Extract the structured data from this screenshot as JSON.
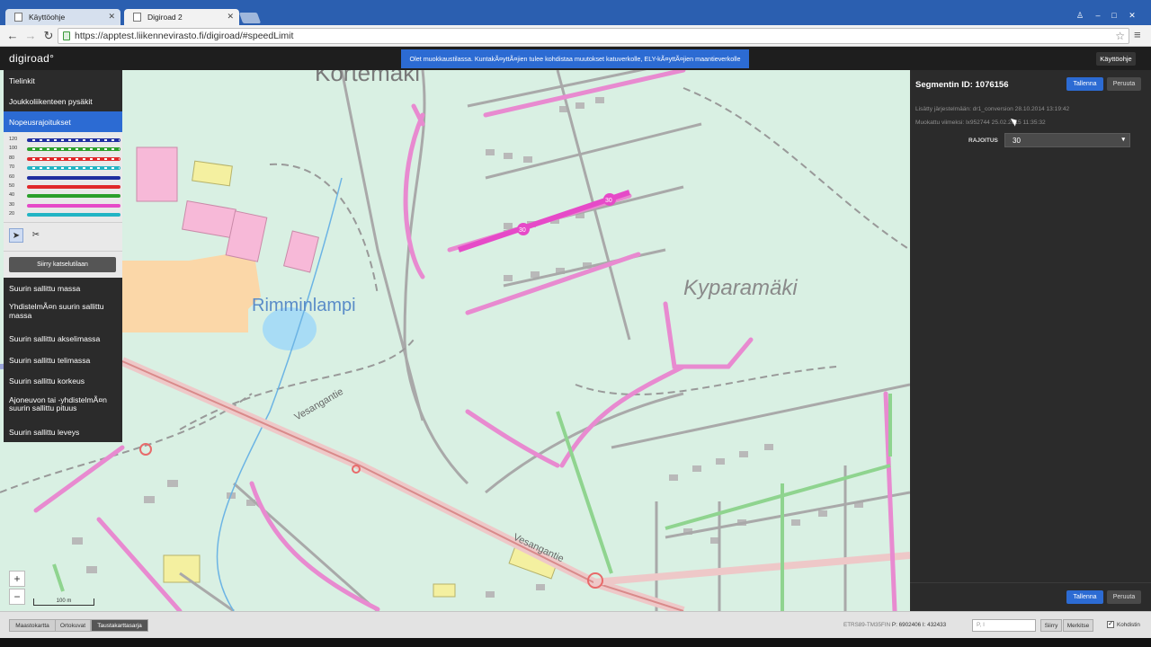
{
  "browser": {
    "tabs": [
      {
        "label": "Käyttöohje",
        "active": false
      },
      {
        "label": "Digiroad 2",
        "active": true
      }
    ],
    "url": "https://apptest.liikennevirasto.fi/digiroad/#speedLimit"
  },
  "header": {
    "logo": "digiroad°",
    "notice": "Olet muokkaustilassa. KuntakÃ¤yttÃ¤jien tulee kohdistaa muutokset katuverkolle, ELY-kÃ¤yttÃ¤jien maantieverkolle",
    "help_label": "Käyttöohje"
  },
  "left_panel": {
    "top_items": [
      {
        "label": "Tielinkit",
        "active": false
      },
      {
        "label": "Joukkoliikenteen pysäkit",
        "active": false
      },
      {
        "label": "Nopeusrajoitukset",
        "active": true
      }
    ],
    "legend": [
      {
        "label": "120",
        "color": "#1f2ea0",
        "dashed": true
      },
      {
        "label": "100",
        "color": "#2ba02b",
        "dashed": true
      },
      {
        "label": "80",
        "color": "#e0282a",
        "dashed": true
      },
      {
        "label": "70",
        "color": "#22b4c4",
        "dashed": true
      },
      {
        "label": "60",
        "color": "#1f2ea0",
        "dashed": false
      },
      {
        "label": "50",
        "color": "#e0282a",
        "dashed": false
      },
      {
        "label": "40",
        "color": "#2ba02b",
        "dashed": false
      },
      {
        "label": "30",
        "color": "#e64ac8",
        "dashed": false
      },
      {
        "label": "20",
        "color": "#22b4c4",
        "dashed": false
      }
    ],
    "view_mode_label": "Siirry katselutilaan",
    "bottom_items": [
      {
        "label": "Suurin sallittu massa"
      },
      {
        "label": "YhdistelmÃ¤n suurin sallittu massa"
      },
      {
        "label": "Suurin sallittu akselimassa"
      },
      {
        "label": "Suurin sallittu telimassa"
      },
      {
        "label": "Suurin sallittu korkeus"
      },
      {
        "label": "Ajoneuvon tai -yhdistelmÃ¤n suurin sallittu pituus"
      },
      {
        "label": "Suurin sallittu leveys"
      }
    ]
  },
  "right_panel": {
    "title": "Segmentin ID: 1076156",
    "save_label": "Tallenna",
    "cancel_label": "Peruuta",
    "added": "Lisätty järjestelmään: dr1_conversion 28.10.2014 13:19:42",
    "modified": "Muokattu viimeksi: lx952744 25.02.2015 11:35:32",
    "limit_label": "RAJOITUS",
    "limit_value": "30"
  },
  "map": {
    "place_names": [
      "Kortemäki",
      "Kyparamäki",
      "Rimminlampi",
      "Vesangantie"
    ],
    "scale_label": "100 m",
    "speed_label": "30"
  },
  "bottom_bar": {
    "backgrounds": [
      {
        "label": "Maastokartta",
        "active": false
      },
      {
        "label": "Ortokuvat",
        "active": false
      },
      {
        "label": "Taustakarttasarja",
        "active": true
      }
    ],
    "crs": "ETRS89-TM35FIN",
    "coord_p": "P: 6902406",
    "coord_i": "I: 432433",
    "search_placeholder": "P, I",
    "goto_label": "Siirry",
    "marker_label": "Merkitse",
    "crosshair_label": "Kohdistin"
  }
}
